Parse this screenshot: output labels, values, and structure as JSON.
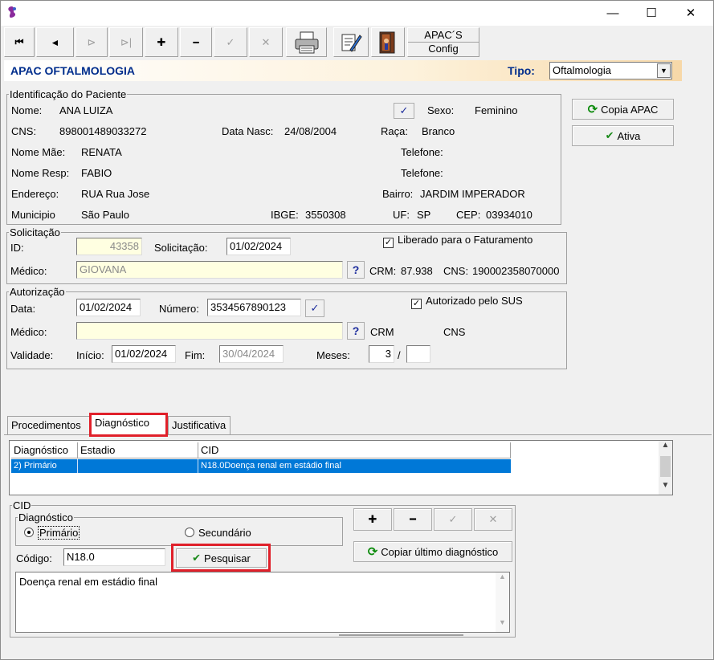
{
  "window": {
    "minimize": "—",
    "maximize": "☐",
    "close": "✕"
  },
  "toolbar": {
    "first": "⏮",
    "prev": "◄",
    "next": "⊳",
    "last": "⊳|",
    "add": "✚",
    "remove": "━",
    "confirm": "✓",
    "cancel": "✕",
    "apacs_line1": "APAC´S",
    "apacs_line2": "Config"
  },
  "header": {
    "title": "APAC OFTALMOLOGIA",
    "tipo_label": "Tipo:",
    "tipo_value": "Oftalmologia"
  },
  "paciente": {
    "legend": "Identificação do Paciente",
    "nome_label": "Nome:",
    "nome_value": "ANA LUIZA",
    "sexo_label": "Sexo:",
    "sexo_value": "Feminino",
    "cns_label": "CNS:",
    "cns_value": "898001489033272",
    "nasc_label": "Data Nasc:",
    "nasc_value": "24/08/2004",
    "raca_label": "Raça:",
    "raca_value": "Branco",
    "mae_label": "Nome Mãe:",
    "mae_value": "RENATA",
    "telefone1_label": "Telefone:",
    "resp_label": "Nome Resp:",
    "resp_value": "FABIO",
    "telefone2_label": "Telefone:",
    "endereco_label": "Endereço:",
    "endereco_value": "RUA Rua Jose",
    "bairro_label": "Bairro:",
    "bairro_value": "JARDIM IMPERADOR",
    "municipio_label": "Municipio",
    "municipio_value": "São Paulo",
    "ibge_label": "IBGE:",
    "ibge_value": "3550308",
    "uf_label": "UF:",
    "uf_value": "SP",
    "cep_label": "CEP:",
    "cep_value": "03934010"
  },
  "side_buttons": {
    "copia": "Copia APAC",
    "ativa": "Ativa"
  },
  "solicitacao": {
    "legend": "Solicitação",
    "id_label": "ID:",
    "id_value": "43358",
    "sol_label": "Solicitação:",
    "sol_value": "01/02/2024",
    "liberado_label": "Liberado para o Faturamento",
    "liberado_checked": true,
    "medico_label": "Médico:",
    "medico_value": "GIOVANA",
    "crm_label": "CRM:",
    "crm_value": "87.938",
    "cns_label": "CNS:",
    "cns_value": "190002358070000"
  },
  "autorizacao": {
    "legend": "Autorização",
    "data_label": "Data:",
    "data_value": "01/02/2024",
    "numero_label": "Número:",
    "numero_value": "3534567890123",
    "sus_label": "Autorizado pelo SUS",
    "sus_checked": true,
    "medico_label": "Médico:",
    "medico_value": "",
    "crm_label": "CRM",
    "cns_label": "CNS",
    "validade_label": "Validade:",
    "inicio_label": "Início:",
    "inicio_value": "01/02/2024",
    "fim_label": "Fim:",
    "fim_value": "30/04/2024",
    "meses_label": "Meses:",
    "meses_value": "3",
    "meses_sep": "/",
    "meses_total": ""
  },
  "tabs": [
    {
      "label": "Procedimentos"
    },
    {
      "label": "Diagnóstico"
    },
    {
      "label": "Justificativa"
    }
  ],
  "grid": {
    "headers": [
      "Diagnóstico",
      "Estadio",
      "CID"
    ],
    "rows": [
      {
        "diagnostico": "2) Primário",
        "estadio": "",
        "cid": "N18.0Doença renal em estádio final"
      }
    ]
  },
  "cid": {
    "legend": "CID",
    "diag_legend": "Diagnóstico",
    "primario_label": "Primário",
    "secundario_label": "Secundário",
    "primario_selected": true,
    "codigo_label": "Código:",
    "codigo_value": "N18.0",
    "pesquisar_label": "Pesquisar",
    "copiar_label": "Copiar último diagnóstico",
    "add": "✚",
    "remove": "━",
    "confirm": "✓",
    "cancel": "✕",
    "descricao": "Doença renal em estádio final"
  },
  "icons": {
    "dropdown": "▼",
    "down_chevron": "✓",
    "question": "?",
    "scroll_up": "▲",
    "scroll_down": "▼"
  }
}
